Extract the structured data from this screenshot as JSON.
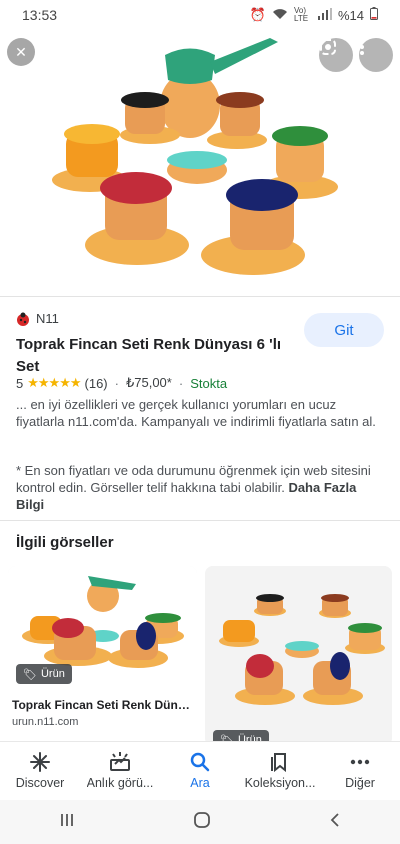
{
  "status": {
    "time": "13:53",
    "battery": "%14",
    "network": "Vo) LTE"
  },
  "hero": {
    "close_label": "✕"
  },
  "result": {
    "source": "N11",
    "title": "Toprak Fincan Seti Renk Dünyası 6 'lı Set",
    "action_label": "Git",
    "rating": "5",
    "stars": "★★★★★",
    "reviews": "(16)",
    "price": "₺75,00*",
    "stock": "Stokta",
    "description": "... en iyi özellikleri ve gerçek kullanıcı yorumları en ucuz fiyatlarla n11.com'da. Kampanyalı ve indirimli fiyatlarla satın al.",
    "note": "* En son fiyatları ve oda durumunu öğrenmek için web sitesini kontrol edin. Görseller telif hakkına tabi olabilir.",
    "more_link": "Daha Fazla Bilgi"
  },
  "related": {
    "title": "İlgili görseller",
    "cards": [
      {
        "badge": "Ürün",
        "title": "Toprak Fincan Seti Renk Dünya...",
        "url": "urun.n11.com"
      },
      {
        "badge": "Ürün"
      }
    ]
  },
  "bottom_nav": [
    {
      "label": "Discover",
      "icon": "asterisk-icon"
    },
    {
      "label": "Anlık görü...",
      "icon": "snapshot-icon"
    },
    {
      "label": "Ara",
      "icon": "search-icon"
    },
    {
      "label": "Koleksiyon...",
      "icon": "bookmark-icon"
    },
    {
      "label": "Diğer",
      "icon": "more-icon"
    }
  ],
  "colors": {
    "accent": "#1a73e8",
    "stock": "#188038",
    "star": "#f5b400"
  }
}
